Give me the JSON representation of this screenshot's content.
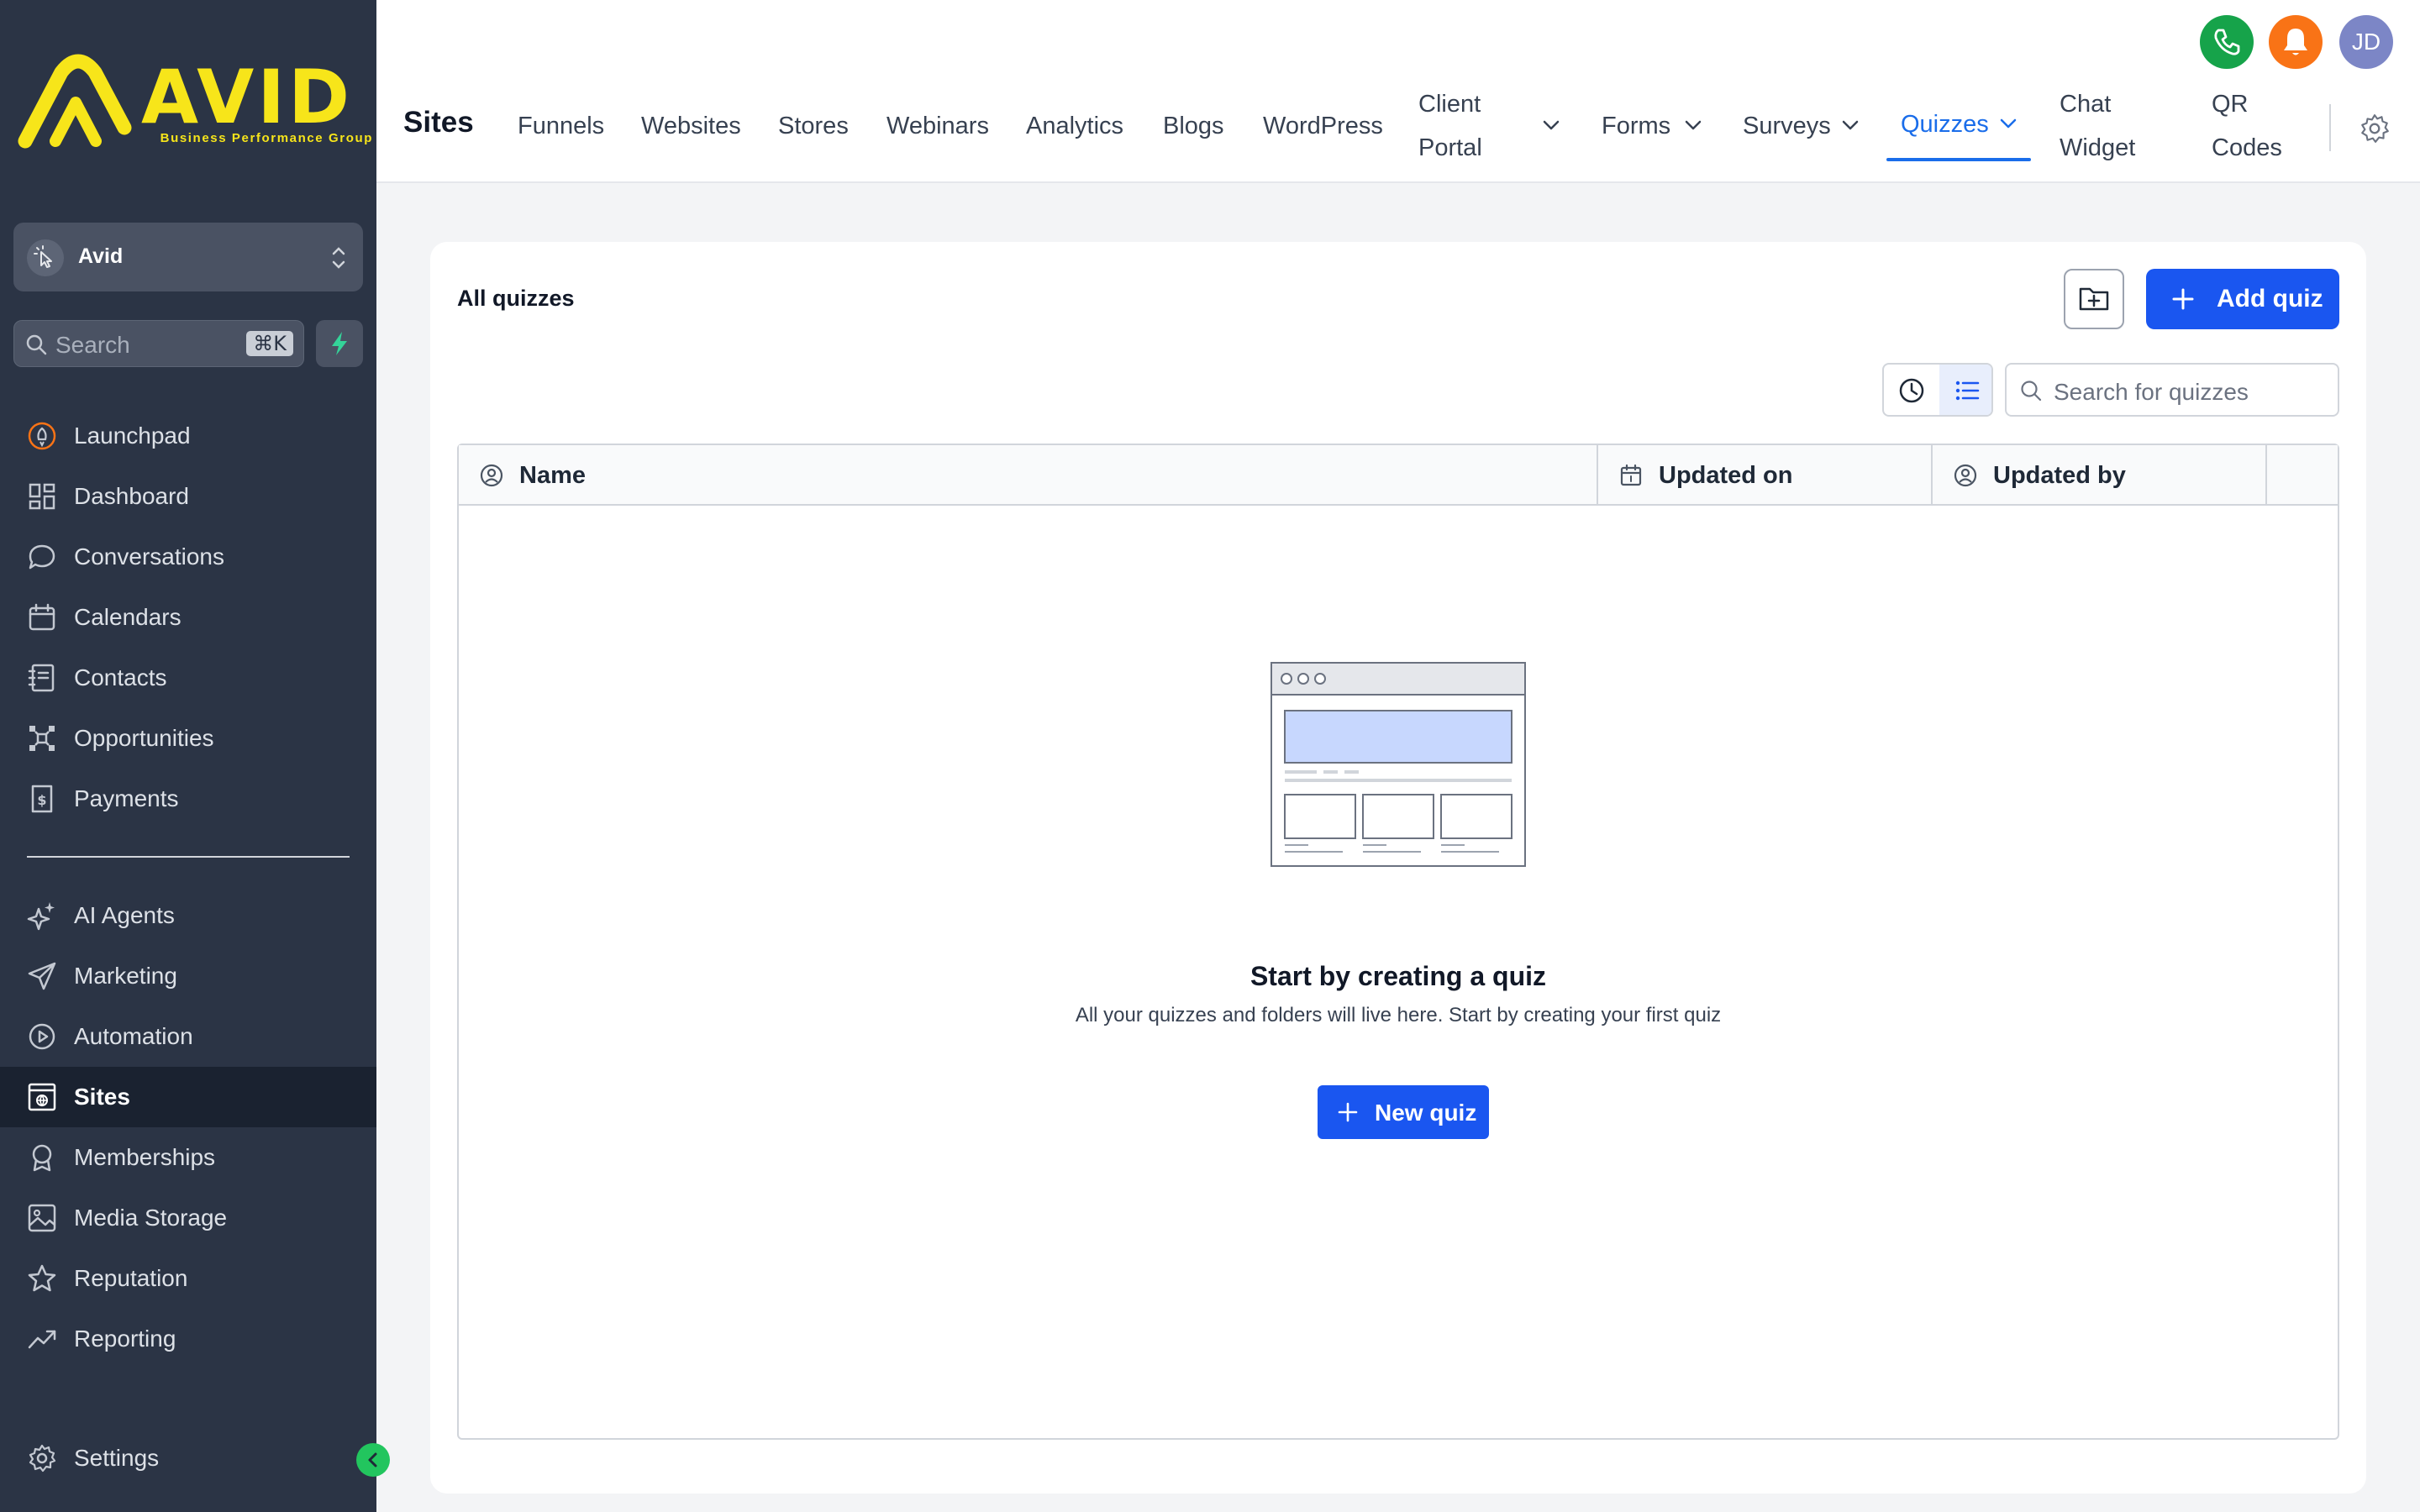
{
  "brand": {
    "logo_word": "AVID",
    "logo_subtitle": "Business Performance Group",
    "logo_color": "#f7e51a"
  },
  "account": {
    "name": "Avid"
  },
  "sidebar_search": {
    "placeholder": "Search",
    "shortcut": "⌘K"
  },
  "sidebar": {
    "items": [
      {
        "label": "Launchpad",
        "icon": "rocket-icon"
      },
      {
        "label": "Dashboard",
        "icon": "grid-icon"
      },
      {
        "label": "Conversations",
        "icon": "chat-bubble-icon"
      },
      {
        "label": "Calendars",
        "icon": "calendar-icon"
      },
      {
        "label": "Contacts",
        "icon": "address-book-icon"
      },
      {
        "label": "Opportunities",
        "icon": "network-icon"
      },
      {
        "label": "Payments",
        "icon": "receipt-icon"
      }
    ],
    "items2": [
      {
        "label": "AI Agents",
        "icon": "sparkle-icon"
      },
      {
        "label": "Marketing",
        "icon": "send-icon"
      },
      {
        "label": "Automation",
        "icon": "play-circle-icon"
      },
      {
        "label": "Sites",
        "icon": "globe-window-icon",
        "active": true
      },
      {
        "label": "Memberships",
        "icon": "badge-icon"
      },
      {
        "label": "Media Storage",
        "icon": "image-icon"
      },
      {
        "label": "Reputation",
        "icon": "star-icon"
      },
      {
        "label": "Reporting",
        "icon": "trend-icon"
      }
    ],
    "settings": {
      "label": "Settings",
      "icon": "gear-icon"
    }
  },
  "topbar": {
    "title": "Sites",
    "tabs": {
      "funnels": "Funnels",
      "websites": "Websites",
      "stores": "Stores",
      "webinars": "Webinars",
      "analytics": "Analytics",
      "blogs": "Blogs",
      "wordpress": "WordPress",
      "client_portal_1": "Client",
      "client_portal_2": "Portal",
      "forms": "Forms",
      "surveys": "Surveys",
      "quizzes": "Quizzes",
      "chat_widget_1": "Chat",
      "chat_widget_2": "Widget",
      "qr_codes_1": "QR",
      "qr_codes_2": "Codes"
    },
    "active_tab": "Quizzes",
    "user_initials": "JD",
    "phone_color": "#16a34a",
    "bell_color": "#f97316",
    "accent_color": "#1a6dea"
  },
  "main": {
    "title": "All quizzes",
    "add_button": "Add quiz",
    "search_placeholder": "Search for quizzes",
    "columns": {
      "name": "Name",
      "updated_on": "Updated on",
      "updated_by": "Updated by"
    },
    "empty": {
      "title": "Start by creating a quiz",
      "description": "All your quizzes and folders will live here. Start by creating your first quiz",
      "button": "New quiz"
    },
    "primary_color": "#1a56f0"
  }
}
